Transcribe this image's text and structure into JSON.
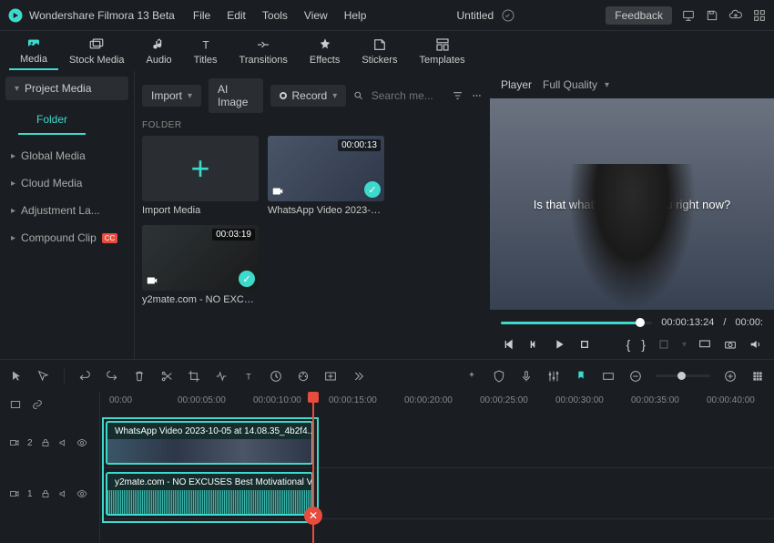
{
  "app": {
    "title": "Wondershare Filmora 13 Beta",
    "doc_title": "Untitled",
    "feedback": "Feedback"
  },
  "menu": [
    "File",
    "Edit",
    "Tools",
    "View",
    "Help"
  ],
  "tabs": [
    {
      "label": "Media",
      "icon": "media"
    },
    {
      "label": "Stock Media",
      "icon": "stock"
    },
    {
      "label": "Audio",
      "icon": "audio"
    },
    {
      "label": "Titles",
      "icon": "titles"
    },
    {
      "label": "Transitions",
      "icon": "transitions"
    },
    {
      "label": "Effects",
      "icon": "effects"
    },
    {
      "label": "Stickers",
      "icon": "stickers"
    },
    {
      "label": "Templates",
      "icon": "templates"
    }
  ],
  "sidebar": {
    "project_media": "Project Media",
    "folder": "Folder",
    "items": [
      {
        "label": "Global Media"
      },
      {
        "label": "Cloud Media"
      },
      {
        "label": "Adjustment La..."
      },
      {
        "label": "Compound Clip",
        "badge": "CC"
      }
    ]
  },
  "center": {
    "import": "Import",
    "ai_image": "AI Image",
    "record": "Record",
    "search_placeholder": "Search me...",
    "folder_label": "FOLDER",
    "items": [
      {
        "name": "Import Media",
        "type": "import"
      },
      {
        "name": "WhatsApp Video 2023-10-05...",
        "duration": "00:00:13",
        "checked": true
      },
      {
        "name": "y2mate.com - NO EXCUSES ...",
        "duration": "00:03:19",
        "checked": true
      }
    ]
  },
  "player": {
    "label": "Player",
    "quality": "Full Quality",
    "preview_text": "Is that what's stopping you right now?",
    "current": "00:00:13:24",
    "sep": "/",
    "total": "00:00:"
  },
  "ruler": [
    "00:00",
    "00:00:05:00",
    "00:00:10:00",
    "00:00:15:00",
    "00:00:20:00",
    "00:00:25:00",
    "00:00:30:00",
    "00:00:35:00",
    "00:00:40:00"
  ],
  "tracks": {
    "t2": "2",
    "t1": "1",
    "clip1": "WhatsApp Video 2023-10-05 at 14.08.35_4b2f4...",
    "clip2": "y2mate.com - NO EXCUSES  Best Motivational V..."
  }
}
